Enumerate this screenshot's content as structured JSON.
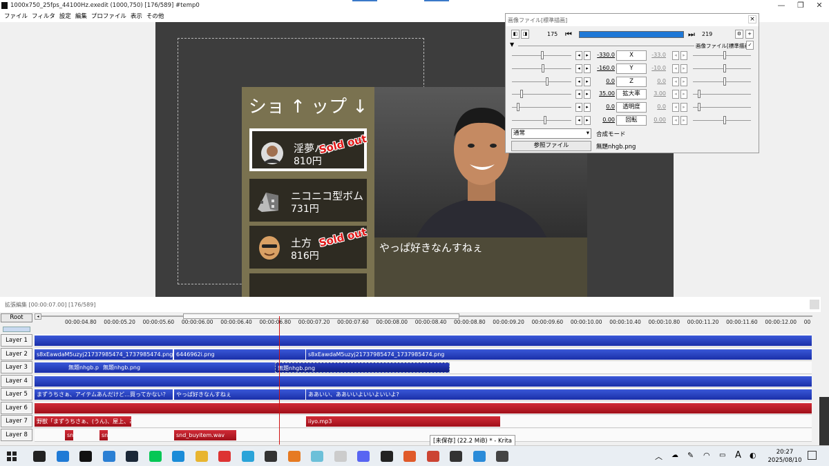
{
  "titlebar": {
    "title": "1000x750_25fps_44100Hz.exedit (1000,750)  [176/589]  #temp0",
    "minimize": "—",
    "restore": "❐",
    "close": "✕"
  },
  "menu": [
    "ファイル",
    "フィルタ",
    "設定",
    "編集",
    "プロファイル",
    "表示",
    "その他"
  ],
  "shop": {
    "title": "ショ ↑ ップ ↓",
    "items": [
      {
        "name": "淫夢バッ",
        "price": "810円",
        "soldout": "Sold out"
      },
      {
        "name": "ニコニコ型ボム",
        "price": "731円",
        "soldout": ""
      },
      {
        "name": "土方",
        "price": "816円",
        "soldout": "Sold out"
      }
    ]
  },
  "speech": "やっぱ好きなんすねぇ",
  "dialog": {
    "title": "画像ファイル[標準描画]",
    "frame_start": "175",
    "frame_end": "219",
    "group_label": "画像ファイル[標準描画]",
    "params": [
      {
        "label": "X",
        "value": "-330.0",
        "value2": "-33.0"
      },
      {
        "label": "Y",
        "value": "-160.0",
        "value2": "-10.0"
      },
      {
        "label": "Z",
        "value": "0.0",
        "value2": "0.0"
      },
      {
        "label": "拡大率",
        "value": "35.00",
        "value2": "3.00"
      },
      {
        "label": "透明度",
        "value": "0.0",
        "value2": "0.0"
      },
      {
        "label": "回転",
        "value": "0.00",
        "value2": "0.00"
      }
    ],
    "blend_select": "通常",
    "blend_label": "合成モード",
    "ref_button": "参照ファイル",
    "filename": "無題nhgb.png"
  },
  "timeline": {
    "title": "拡張編集 [00:00:07.00] [176/589]",
    "root": "Root",
    "ticks": [
      "00:00:04.80",
      "00:00:05.20",
      "00:00:05.60",
      "00:00:06.00",
      "00:00:06.40",
      "00:00:06.80",
      "00:00:07.20",
      "00:00:07.60",
      "00:00:08.00",
      "00:00:08.40",
      "00:00:08.80",
      "00:00:09.20",
      "00:00:09.60",
      "00:00:10.00",
      "00:00:10.40",
      "00:00:10.80",
      "00:00:11.20",
      "00:00:11.60",
      "00:00:12.00",
      "00"
    ],
    "layers": [
      "Layer 1",
      "Layer 2",
      "Layer 3",
      "Layer 4",
      "Layer 5",
      "Layer 6",
      "Layer 7",
      "Layer 8"
    ],
    "clip_text": {
      "l2a": "s8xEawdaM5uzyj21737985474_1737985474.png",
      "l2b": "6446962i.png",
      "l2c": "s8xEawdaM5uzyj21737985474_1737985474.png",
      "l3a": "無題nhgb.p",
      "l3b": "無題nhgb.png",
      "l3c": "無題nhgb.png",
      "l5a": "まずうちさぁ、アイテムあんだけど…買ってかない？",
      "l5b": "やっぱ好きなんすねぇ",
      "l5c": "ああいい、ああいいよいいよいいよ?",
      "l7a": "野獣「まずうちさぁ、(うん)、屋上、あんだ",
      "l7b": "iiyo.mp3",
      "l8a": "sn",
      "l8b": "sn",
      "l8c": "snd_buyitem.wav"
    }
  },
  "krita_tip": "[未保存]  (22.2 MiB) * - Krita",
  "clock": {
    "time": "20:27",
    "date": "2025/08/10"
  },
  "ime": "A"
}
